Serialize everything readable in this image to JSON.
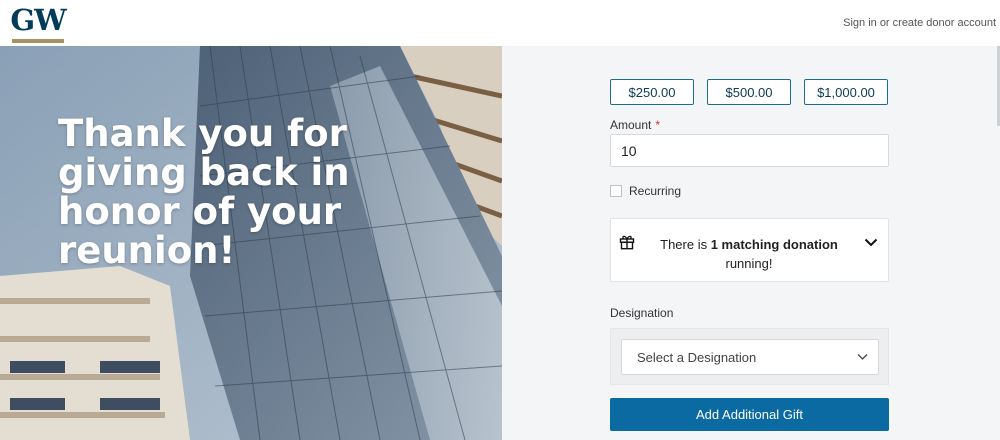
{
  "header": {
    "logo_text": "GW",
    "signin_link": "Sign in or create donor account"
  },
  "hero": {
    "headline": "Thank you for giving back in honor of your reunion!"
  },
  "donation": {
    "preset_amounts": [
      "$250.00",
      "$500.00",
      "$1,000.00"
    ],
    "amount_label": "Amount",
    "required_marker": "*",
    "amount_value": "10",
    "recurring_label": "Recurring",
    "recurring_checked": false,
    "matching": {
      "text_before": "There is ",
      "text_bold": "1 matching donation",
      "text_after": " running!",
      "icon": "gift-icon",
      "toggle_icon": "chevron-down-icon"
    },
    "designation_label": "Designation",
    "designation_placeholder": "Select a Designation",
    "add_button": "Add Additional Gift"
  },
  "colors": {
    "brand_navy": "#033c5a",
    "brand_gold": "#a69362",
    "button_blue": "#0a6aa1",
    "required_red": "#d32f2f"
  }
}
